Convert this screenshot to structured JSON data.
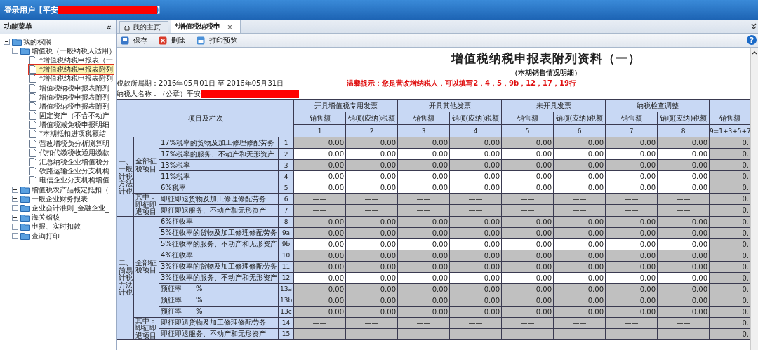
{
  "header": {
    "user_label": "登录用户【平安",
    "user_suffix": "】"
  },
  "sidebar": {
    "title": "功能菜单",
    "collapse": "«",
    "tree": [
      {
        "label": "我的权限",
        "kind": "folder",
        "expanded": true,
        "children": [
          {
            "label": "增值税（一般纳税人适用）",
            "kind": "folder",
            "expanded": true,
            "children": [
              {
                "label": "*增值税纳税申报表（一",
                "kind": "file",
                "selected": false
              },
              {
                "label": "*增值税纳税申报表附列",
                "kind": "file",
                "selected": true
              },
              {
                "label": "*增值税纳税申报表附列",
                "kind": "file",
                "selected": false
              },
              {
                "label": "增值税纳税申报表附列",
                "kind": "file",
                "selected": false
              },
              {
                "label": "增值税纳税申报表附列",
                "kind": "file",
                "selected": false
              },
              {
                "label": "增值税纳税申报表附列",
                "kind": "file",
                "selected": false
              },
              {
                "label": "固定资产（不含不动产",
                "kind": "file",
                "selected": false
              },
              {
                "label": "增值税减免税申报明细",
                "kind": "file",
                "selected": false
              },
              {
                "label": "*本期抵扣进项税额结",
                "kind": "file",
                "selected": false
              },
              {
                "label": "营改增税负分析测算明",
                "kind": "file",
                "selected": false
              },
              {
                "label": "代扣代缴税收通用缴款",
                "kind": "file",
                "selected": false
              },
              {
                "label": "汇总纳税企业增值税分",
                "kind": "file",
                "selected": false
              },
              {
                "label": "铁路运输企业分支机构",
                "kind": "file",
                "selected": false
              },
              {
                "label": "电信企业分支机构增值",
                "kind": "file",
                "selected": false
              }
            ]
          },
          {
            "label": "增值税农产品核定抵扣（",
            "kind": "folder",
            "expanded": false
          },
          {
            "label": "一般企业财务报表",
            "kind": "folder",
            "expanded": false
          },
          {
            "label": "企业会计准则_金融企业_",
            "kind": "folder",
            "expanded": false
          },
          {
            "label": "海关稽核",
            "kind": "folder",
            "expanded": false
          },
          {
            "label": "申报、实时扣款",
            "kind": "folder",
            "expanded": false
          },
          {
            "label": "查询打印",
            "kind": "folder",
            "expanded": false
          }
        ]
      }
    ]
  },
  "tabs": [
    {
      "label": "我的主页",
      "selected": false
    },
    {
      "label": "*增值税纳税申",
      "selected": true,
      "close": "×"
    }
  ],
  "toolbar": [
    {
      "label": "保存"
    },
    {
      "label": "删除"
    },
    {
      "label": "打印预览"
    }
  ],
  "help": "?",
  "form": {
    "title": "增值税纳税申报表附列资料（一）",
    "subtitle": "（本期销售情况明细）",
    "period": "税款所属期：2016年05月01日 至 2016年05月31日",
    "notice": "温馨提示：您是营改增纳税人，可以填写2，4，5，9b，12，17，19行",
    "taxpayer": "纳税人名称：（公章）平安"
  },
  "table": {
    "corner": "项目及栏次",
    "groups": [
      "开具增值税专用发票",
      "开具其他发票",
      "未开具发票",
      "纳税检查调整"
    ],
    "columns": [
      {
        "label": "销售额",
        "index": "1"
      },
      {
        "label": "销项(应纳)税额",
        "index": "2"
      },
      {
        "label": "销售额",
        "index": "3"
      },
      {
        "label": "销项(应纳)税额",
        "index": "4"
      },
      {
        "label": "销售额",
        "index": "5"
      },
      {
        "label": "销项(应纳)税额",
        "index": "6"
      },
      {
        "label": "销售额",
        "index": "7"
      },
      {
        "label": "销项(应纳)税额",
        "index": "8"
      },
      {
        "label": "销售额",
        "index": "9=1+3+5+7"
      }
    ],
    "sections": [
      {
        "label": "一、一般计税方法计税",
        "subsections": [
          {
            "label": "全部征税项目",
            "rows": [
              {
                "item": "17%税率的货物及加工修理修配劳务",
                "line": "1",
                "cells": [
                  {
                    "value": "0.00",
                    "editable": false,
                    "kind": "amount"
                  },
                  {
                    "value": "0.00",
                    "editable": false,
                    "kind": "amount"
                  },
                  {
                    "value": "0.00",
                    "editable": false,
                    "kind": "amount"
                  },
                  {
                    "value": "0.00",
                    "editable": false,
                    "kind": "amount"
                  },
                  {
                    "value": "0.00",
                    "editable": false,
                    "kind": "amount"
                  },
                  {
                    "value": "0.00",
                    "editable": false,
                    "kind": "amount"
                  },
                  {
                    "value": "0.00",
                    "editable": false,
                    "kind": "amount"
                  },
                  {
                    "value": "0.00",
                    "editable": false,
                    "kind": "amount"
                  },
                  {
                    "value": "0.",
                    "editable": false,
                    "kind": "amount"
                  }
                ]
              },
              {
                "item": "17%税率的服务、不动产和无形资产",
                "line": "2",
                "cells": [
                  {
                    "value": "0.00",
                    "editable": true,
                    "kind": "amount"
                  },
                  {
                    "value": "0.00",
                    "editable": true,
                    "kind": "amount"
                  },
                  {
                    "value": "0.00",
                    "editable": true,
                    "kind": "amount"
                  },
                  {
                    "value": "0.00",
                    "editable": true,
                    "kind": "amount"
                  },
                  {
                    "value": "0.00",
                    "editable": true,
                    "kind": "amount"
                  },
                  {
                    "value": "0.00",
                    "editable": true,
                    "kind": "amount"
                  },
                  {
                    "value": "0.00",
                    "editable": true,
                    "kind": "amount"
                  },
                  {
                    "value": "0.00",
                    "editable": true,
                    "kind": "amount"
                  },
                  {
                    "value": "0.",
                    "editable": false,
                    "kind": "amount"
                  }
                ]
              },
              {
                "item": "13%税率",
                "line": "3",
                "cells": [
                  {
                    "value": "0.00",
                    "editable": false,
                    "kind": "amount"
                  },
                  {
                    "value": "0.00",
                    "editable": false,
                    "kind": "amount"
                  },
                  {
                    "value": "0.00",
                    "editable": false,
                    "kind": "amount"
                  },
                  {
                    "value": "0.00",
                    "editable": false,
                    "kind": "amount"
                  },
                  {
                    "value": "0.00",
                    "editable": false,
                    "kind": "amount"
                  },
                  {
                    "value": "0.00",
                    "editable": false,
                    "kind": "amount"
                  },
                  {
                    "value": "0.00",
                    "editable": false,
                    "kind": "amount"
                  },
                  {
                    "value": "0.00",
                    "editable": false,
                    "kind": "amount"
                  },
                  {
                    "value": "0.",
                    "editable": false,
                    "kind": "amount"
                  }
                ]
              },
              {
                "item": "11%税率",
                "line": "4",
                "cells": [
                  {
                    "value": "0.00",
                    "editable": true,
                    "kind": "amount"
                  },
                  {
                    "value": "0.00",
                    "editable": true,
                    "kind": "amount"
                  },
                  {
                    "value": "0.00",
                    "editable": true,
                    "kind": "amount"
                  },
                  {
                    "value": "0.00",
                    "editable": true,
                    "kind": "amount"
                  },
                  {
                    "value": "0.00",
                    "editable": true,
                    "kind": "amount"
                  },
                  {
                    "value": "0.00",
                    "editable": true,
                    "kind": "amount"
                  },
                  {
                    "value": "0.00",
                    "editable": true,
                    "kind": "amount"
                  },
                  {
                    "value": "0.00",
                    "editable": true,
                    "kind": "amount"
                  },
                  {
                    "value": "0.",
                    "editable": false,
                    "kind": "amount"
                  }
                ]
              },
              {
                "item": "6%税率",
                "line": "5",
                "cells": [
                  {
                    "value": "0.00",
                    "editable": true,
                    "kind": "amount"
                  },
                  {
                    "value": "0.00",
                    "editable": true,
                    "kind": "amount"
                  },
                  {
                    "value": "0.00",
                    "editable": true,
                    "kind": "amount"
                  },
                  {
                    "value": "0.00",
                    "editable": true,
                    "kind": "amount"
                  },
                  {
                    "value": "0.00",
                    "editable": true,
                    "kind": "amount"
                  },
                  {
                    "value": "0.00",
                    "editable": true,
                    "kind": "amount"
                  },
                  {
                    "value": "0.00",
                    "editable": true,
                    "kind": "amount"
                  },
                  {
                    "value": "0.00",
                    "editable": true,
                    "kind": "amount"
                  },
                  {
                    "value": "0.",
                    "editable": false,
                    "kind": "amount"
                  }
                ]
              }
            ]
          },
          {
            "label": "其中：即征即退项目",
            "rows": [
              {
                "item": "即征即退货物及加工修理修配劳务",
                "line": "6",
                "cells": [
                  {
                    "value": "——",
                    "editable": false,
                    "kind": "na"
                  },
                  {
                    "value": "——",
                    "editable": false,
                    "kind": "na"
                  },
                  {
                    "value": "——",
                    "editable": false,
                    "kind": "na"
                  },
                  {
                    "value": "——",
                    "editable": false,
                    "kind": "na"
                  },
                  {
                    "value": "——",
                    "editable": false,
                    "kind": "na"
                  },
                  {
                    "value": "——",
                    "editable": false,
                    "kind": "na"
                  },
                  {
                    "value": "——",
                    "editable": false,
                    "kind": "na"
                  },
                  {
                    "value": "——",
                    "editable": false,
                    "kind": "na"
                  },
                  {
                    "value": "0.",
                    "editable": false,
                    "kind": "amount"
                  }
                ]
              },
              {
                "item": "即征即退服务、不动产和无形资产",
                "line": "7",
                "cells": [
                  {
                    "value": "——",
                    "editable": false,
                    "kind": "na"
                  },
                  {
                    "value": "——",
                    "editable": false,
                    "kind": "na"
                  },
                  {
                    "value": "——",
                    "editable": false,
                    "kind": "na"
                  },
                  {
                    "value": "——",
                    "editable": false,
                    "kind": "na"
                  },
                  {
                    "value": "——",
                    "editable": false,
                    "kind": "na"
                  },
                  {
                    "value": "——",
                    "editable": false,
                    "kind": "na"
                  },
                  {
                    "value": "——",
                    "editable": false,
                    "kind": "na"
                  },
                  {
                    "value": "——",
                    "editable": false,
                    "kind": "na"
                  },
                  {
                    "value": "0.",
                    "editable": false,
                    "kind": "amount"
                  }
                ]
              }
            ]
          }
        ]
      },
      {
        "label": "二、简易计税方法计税",
        "subsections": [
          {
            "label": "全部征税项目",
            "rows": [
              {
                "item": "6%征收率",
                "line": "8",
                "cells": [
                  {
                    "value": "0.00",
                    "editable": false,
                    "kind": "amount"
                  },
                  {
                    "value": "0.00",
                    "editable": false,
                    "kind": "amount"
                  },
                  {
                    "value": "0.00",
                    "editable": false,
                    "kind": "amount"
                  },
                  {
                    "value": "0.00",
                    "editable": false,
                    "kind": "amount"
                  },
                  {
                    "value": "0.00",
                    "editable": false,
                    "kind": "amount"
                  },
                  {
                    "value": "0.00",
                    "editable": false,
                    "kind": "amount"
                  },
                  {
                    "value": "0.00",
                    "editable": false,
                    "kind": "amount"
                  },
                  {
                    "value": "0.00",
                    "editable": false,
                    "kind": "amount"
                  },
                  {
                    "value": "0.",
                    "editable": false,
                    "kind": "amount"
                  }
                ]
              },
              {
                "item": "5%征收率的货物及加工修理修配劳务",
                "line": "9a",
                "cells": [
                  {
                    "value": "0.00",
                    "editable": false,
                    "kind": "amount"
                  },
                  {
                    "value": "0.00",
                    "editable": false,
                    "kind": "amount"
                  },
                  {
                    "value": "0.00",
                    "editable": false,
                    "kind": "amount"
                  },
                  {
                    "value": "0.00",
                    "editable": false,
                    "kind": "amount"
                  },
                  {
                    "value": "0.00",
                    "editable": false,
                    "kind": "amount"
                  },
                  {
                    "value": "0.00",
                    "editable": false,
                    "kind": "amount"
                  },
                  {
                    "value": "0.00",
                    "editable": false,
                    "kind": "amount"
                  },
                  {
                    "value": "0.00",
                    "editable": false,
                    "kind": "amount"
                  },
                  {
                    "value": "0.",
                    "editable": false,
                    "kind": "amount"
                  }
                ]
              },
              {
                "item": "5%征收率的服务、不动产和无形资产",
                "line": "9b",
                "cells": [
                  {
                    "value": "0.00",
                    "editable": true,
                    "kind": "amount"
                  },
                  {
                    "value": "0.00",
                    "editable": true,
                    "kind": "amount"
                  },
                  {
                    "value": "0.00",
                    "editable": true,
                    "kind": "amount"
                  },
                  {
                    "value": "0.00",
                    "editable": true,
                    "kind": "amount"
                  },
                  {
                    "value": "0.00",
                    "editable": true,
                    "kind": "amount"
                  },
                  {
                    "value": "0.00",
                    "editable": true,
                    "kind": "amount"
                  },
                  {
                    "value": "0.00",
                    "editable": true,
                    "kind": "amount"
                  },
                  {
                    "value": "0.00",
                    "editable": true,
                    "kind": "amount"
                  },
                  {
                    "value": "0.",
                    "editable": false,
                    "kind": "amount"
                  }
                ]
              },
              {
                "item": "4%征收率",
                "line": "10",
                "cells": [
                  {
                    "value": "0.00",
                    "editable": false,
                    "kind": "amount"
                  },
                  {
                    "value": "0.00",
                    "editable": false,
                    "kind": "amount"
                  },
                  {
                    "value": "0.00",
                    "editable": false,
                    "kind": "amount"
                  },
                  {
                    "value": "0.00",
                    "editable": false,
                    "kind": "amount"
                  },
                  {
                    "value": "0.00",
                    "editable": false,
                    "kind": "amount"
                  },
                  {
                    "value": "0.00",
                    "editable": false,
                    "kind": "amount"
                  },
                  {
                    "value": "0.00",
                    "editable": false,
                    "kind": "amount"
                  },
                  {
                    "value": "0.00",
                    "editable": false,
                    "kind": "amount"
                  },
                  {
                    "value": "0.",
                    "editable": false,
                    "kind": "amount"
                  }
                ]
              },
              {
                "item": "3%征收率的货物及加工修理修配劳务",
                "line": "11",
                "cells": [
                  {
                    "value": "0.00",
                    "editable": false,
                    "kind": "amount"
                  },
                  {
                    "value": "0.00",
                    "editable": false,
                    "kind": "amount"
                  },
                  {
                    "value": "0.00",
                    "editable": false,
                    "kind": "amount"
                  },
                  {
                    "value": "0.00",
                    "editable": false,
                    "kind": "amount"
                  },
                  {
                    "value": "0.00",
                    "editable": false,
                    "kind": "amount"
                  },
                  {
                    "value": "0.00",
                    "editable": false,
                    "kind": "amount"
                  },
                  {
                    "value": "0.00",
                    "editable": false,
                    "kind": "amount"
                  },
                  {
                    "value": "0.00",
                    "editable": false,
                    "kind": "amount"
                  },
                  {
                    "value": "0.",
                    "editable": false,
                    "kind": "amount"
                  }
                ]
              },
              {
                "item": "3%征收率的服务、不动产和无形资产",
                "line": "12",
                "cells": [
                  {
                    "value": "0.00",
                    "editable": true,
                    "kind": "amount"
                  },
                  {
                    "value": "0.00",
                    "editable": true,
                    "kind": "amount"
                  },
                  {
                    "value": "0.00",
                    "editable": true,
                    "kind": "amount"
                  },
                  {
                    "value": "0.00",
                    "editable": true,
                    "kind": "amount"
                  },
                  {
                    "value": "0.00",
                    "editable": true,
                    "kind": "amount"
                  },
                  {
                    "value": "0.00",
                    "editable": true,
                    "kind": "amount"
                  },
                  {
                    "value": "0.00",
                    "editable": true,
                    "kind": "amount"
                  },
                  {
                    "value": "0.00",
                    "editable": true,
                    "kind": "amount"
                  },
                  {
                    "value": "0.",
                    "editable": false,
                    "kind": "amount"
                  }
                ]
              },
              {
                "item": "预征率　　%",
                "line": "13a",
                "cells": [
                  {
                    "value": "0.00",
                    "editable": false,
                    "kind": "amount"
                  },
                  {
                    "value": "0.00",
                    "editable": false,
                    "kind": "amount"
                  },
                  {
                    "value": "0.00",
                    "editable": false,
                    "kind": "amount"
                  },
                  {
                    "value": "0.00",
                    "editable": false,
                    "kind": "amount"
                  },
                  {
                    "value": "0.00",
                    "editable": false,
                    "kind": "amount"
                  },
                  {
                    "value": "0.00",
                    "editable": false,
                    "kind": "amount"
                  },
                  {
                    "value": "0.00",
                    "editable": false,
                    "kind": "amount"
                  },
                  {
                    "value": "0.00",
                    "editable": false,
                    "kind": "amount"
                  },
                  {
                    "value": "0.",
                    "editable": false,
                    "kind": "amount"
                  }
                ]
              },
              {
                "item": "预征率　　%",
                "line": "13b",
                "cells": [
                  {
                    "value": "0.00",
                    "editable": false,
                    "kind": "amount"
                  },
                  {
                    "value": "0.00",
                    "editable": false,
                    "kind": "amount"
                  },
                  {
                    "value": "0.00",
                    "editable": false,
                    "kind": "amount"
                  },
                  {
                    "value": "0.00",
                    "editable": false,
                    "kind": "amount"
                  },
                  {
                    "value": "0.00",
                    "editable": false,
                    "kind": "amount"
                  },
                  {
                    "value": "0.00",
                    "editable": false,
                    "kind": "amount"
                  },
                  {
                    "value": "0.00",
                    "editable": false,
                    "kind": "amount"
                  },
                  {
                    "value": "0.00",
                    "editable": false,
                    "kind": "amount"
                  },
                  {
                    "value": "0.",
                    "editable": false,
                    "kind": "amount"
                  }
                ]
              },
              {
                "item": "预征率　　%",
                "line": "13c",
                "cells": [
                  {
                    "value": "0.00",
                    "editable": false,
                    "kind": "amount"
                  },
                  {
                    "value": "0.00",
                    "editable": false,
                    "kind": "amount"
                  },
                  {
                    "value": "0.00",
                    "editable": false,
                    "kind": "amount"
                  },
                  {
                    "value": "0.00",
                    "editable": false,
                    "kind": "amount"
                  },
                  {
                    "value": "0.00",
                    "editable": false,
                    "kind": "amount"
                  },
                  {
                    "value": "0.00",
                    "editable": false,
                    "kind": "amount"
                  },
                  {
                    "value": "0.00",
                    "editable": false,
                    "kind": "amount"
                  },
                  {
                    "value": "0.00",
                    "editable": false,
                    "kind": "amount"
                  },
                  {
                    "value": "0.",
                    "editable": false,
                    "kind": "amount"
                  }
                ]
              }
            ]
          },
          {
            "label": "其中：即征即退项目",
            "rows": [
              {
                "item": "即征即退货物及加工修理修配劳务",
                "line": "14",
                "cells": [
                  {
                    "value": "——",
                    "editable": false,
                    "kind": "na"
                  },
                  {
                    "value": "——",
                    "editable": false,
                    "kind": "na"
                  },
                  {
                    "value": "——",
                    "editable": false,
                    "kind": "na"
                  },
                  {
                    "value": "——",
                    "editable": false,
                    "kind": "na"
                  },
                  {
                    "value": "——",
                    "editable": false,
                    "kind": "na"
                  },
                  {
                    "value": "——",
                    "editable": false,
                    "kind": "na"
                  },
                  {
                    "value": "——",
                    "editable": false,
                    "kind": "na"
                  },
                  {
                    "value": "——",
                    "editable": false,
                    "kind": "na"
                  },
                  {
                    "value": "0.",
                    "editable": false,
                    "kind": "amount"
                  }
                ]
              },
              {
                "item": "即征即退服务、不动产和无形资产",
                "line": "15",
                "cells": [
                  {
                    "value": "——",
                    "editable": false,
                    "kind": "na"
                  },
                  {
                    "value": "——",
                    "editable": false,
                    "kind": "na"
                  },
                  {
                    "value": "——",
                    "editable": false,
                    "kind": "na"
                  },
                  {
                    "value": "——",
                    "editable": false,
                    "kind": "na"
                  },
                  {
                    "value": "——",
                    "editable": false,
                    "kind": "na"
                  },
                  {
                    "value": "——",
                    "editable": false,
                    "kind": "na"
                  },
                  {
                    "value": "——",
                    "editable": false,
                    "kind": "na"
                  },
                  {
                    "value": "——",
                    "editable": false,
                    "kind": "na"
                  },
                  {
                    "value": "0.",
                    "editable": false,
                    "kind": "amount"
                  }
                ]
              }
            ]
          }
        ]
      }
    ]
  }
}
